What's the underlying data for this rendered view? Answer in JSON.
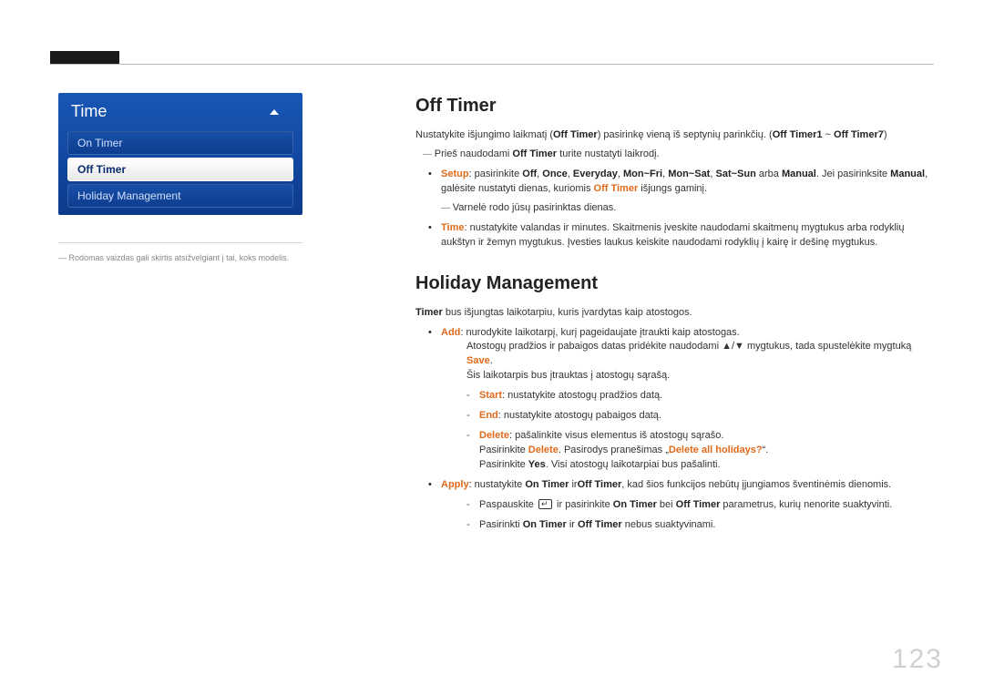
{
  "panel": {
    "title": "Time",
    "items": [
      "On Timer",
      "Off Timer",
      "Holiday Management"
    ],
    "selected": 1
  },
  "caption": "Rodomas vaizdas gali skirtis atsižvelgiant į tai, koks modelis.",
  "section1": {
    "title": "Off Timer",
    "intro_a": "Nustatykite išjungimo laikmatį (",
    "intro_b": ") pasirinkę vieną iš septynių parinkčių. (",
    "intro_c": " ~ ",
    "intro_d": ")",
    "bold": {
      "ot": "Off Timer",
      "o1": "Off Timer1",
      "o7": "Off Timer7"
    },
    "pre_a": "Prieš naudodami ",
    "pre_b": " turite nustatyti laikrodį.",
    "li1": {
      "setup": "Setup",
      "t1": ": pasirinkite ",
      "off": "Off",
      "c": ", ",
      "once": "Once",
      "ev": "Everyday",
      "mf": "Mon~Fri",
      "ms": "Mon~Sat",
      "ss": "Sat~Sun",
      "arba": " arba ",
      "man": "Manual",
      "t2": ". Jei pasirinksite ",
      "t3": ", galėsite nustatyti dienas, kuriomis ",
      "t4": " išjungs gaminį."
    },
    "dash1": "Varnelė rodo jūsų pasirinktas dienas.",
    "li2": {
      "time": "Time",
      "txt": ": nustatykite valandas ir minutes. Skaitmenis įveskite naudodami skaitmenų mygtukus arba rodyklių aukštyn ir žemyn mygtukus. Įvesties laukus keiskite naudodami rodyklių į kairę ir dešinę mygtukus."
    }
  },
  "section2": {
    "title": "Holiday Management",
    "p_a": "Timer",
    "p_b": " bus išjungtas laikotarpiu, kuris įvardytas kaip atostogos.",
    "li1": {
      "add": "Add",
      "t": ": nurodykite laikotarpį, kurį pageidaujate įtraukti kaip atostogas."
    },
    "li1d": {
      "a": "Atostogų pradžios ir pabaigos datas pridėkite naudodami ▲/▼ mygtukus, tada spustelėkite mygtuką ",
      "save": "Save",
      "b": "."
    },
    "li1e": "Šis laikotarpis bus įtrauktas į atostogų sąrašą.",
    "sub": [
      {
        "k": "Start",
        "v": ": nustatykite atostogų pradžios datą."
      },
      {
        "k": "End",
        "v": ": nustatykite atostogų pabaigos datą."
      },
      {
        "k": "Delete",
        "v": ": pašalinkite visus elementus iš atostogų sąrašo."
      }
    ],
    "del": {
      "a": "Pasirinkite ",
      "d": "Delete",
      "b": ". Pasirodys pranešimas „",
      "q": "Delete all holidays?",
      "c": "“."
    },
    "yes": {
      "a": "Pasirinkite ",
      "y": "Yes",
      "b": ". Visi atostogų laikotarpiai bus pašalinti."
    },
    "li2": {
      "apply": "Apply",
      "a": ": nustatykite ",
      "ot": "On Timer",
      "b": " ir",
      "of": "Off Timer",
      "c": ", kad šios funkcijos nebūtų įjungiamos šventinėmis dienomis."
    },
    "d1": {
      "a": "Paspauskite ",
      "b": " ir pasirinkite ",
      "ot": "On Timer",
      "c": " bei ",
      "of": "Off Timer",
      "d": " parametrus, kurių nenorite suaktyvinti."
    },
    "d2": {
      "a": "Pasirinkti ",
      "ot": "On Timer",
      "b": " ir ",
      "of": "Off Timer",
      "c": " nebus suaktyvinami."
    }
  },
  "page": "123"
}
